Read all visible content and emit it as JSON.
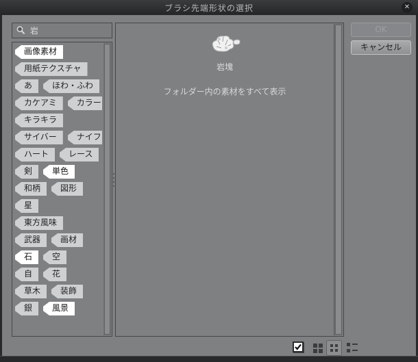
{
  "window": {
    "title": "ブラシ先端形状の選択",
    "close_glyph": "✕"
  },
  "colors": {
    "dialog_bg": "#7e8082",
    "titlebar_bg": "#2b2c2d",
    "panel_border": "#45474a",
    "tag_bg": "#cfd0d1",
    "tag_selected_bg": "#ffffff",
    "icon_dark": "#3a3c3e"
  },
  "search": {
    "value": "岩",
    "icon": "magnifier-icon"
  },
  "tags": {
    "rows": [
      [
        {
          "label": "画像素材",
          "selected": true
        }
      ],
      [
        {
          "label": "用紙テクスチャ",
          "selected": false
        }
      ],
      [
        {
          "label": "あ",
          "selected": false
        },
        {
          "label": "ほわ・ふわ",
          "selected": false
        }
      ],
      [
        {
          "label": "カケアミ",
          "selected": false
        },
        {
          "label": "カラー",
          "selected": false
        }
      ],
      [
        {
          "label": "キラキラ",
          "selected": false
        }
      ],
      [
        {
          "label": "サイバー",
          "selected": false
        },
        {
          "label": "ナイフ",
          "selected": false
        }
      ],
      [
        {
          "label": "ハート",
          "selected": false
        },
        {
          "label": "レース",
          "selected": false
        }
      ],
      [
        {
          "label": "剣",
          "selected": false
        },
        {
          "label": "単色",
          "selected": true
        }
      ],
      [
        {
          "label": "和柄",
          "selected": false
        },
        {
          "label": "図形",
          "selected": false
        }
      ],
      [
        {
          "label": "星",
          "selected": false
        }
      ],
      [
        {
          "label": "東方風味",
          "selected": false
        }
      ],
      [
        {
          "label": "武器",
          "selected": false
        },
        {
          "label": "画材",
          "selected": false
        }
      ],
      [
        {
          "label": "石",
          "selected": true
        },
        {
          "label": "空",
          "selected": false
        }
      ],
      [
        {
          "label": "自",
          "selected": false
        },
        {
          "label": "花",
          "selected": false
        }
      ],
      [
        {
          "label": "草木",
          "selected": false
        },
        {
          "label": "装飾",
          "selected": false
        }
      ],
      [
        {
          "label": "銀",
          "selected": false
        },
        {
          "label": "風景",
          "selected": true
        }
      ]
    ]
  },
  "materials": {
    "item_label": "岩塊",
    "item_icon": "rock-thumbnail",
    "show_all_label": "フォルダー内の素材をすべて表示"
  },
  "actions": {
    "ok_label": "OK",
    "ok_enabled": false,
    "cancel_label": "キャンセル"
  },
  "view_bar": {
    "filter_checked": true,
    "modes": [
      "grid-large",
      "grid-small",
      "list"
    ],
    "selected_mode": "grid-small"
  }
}
